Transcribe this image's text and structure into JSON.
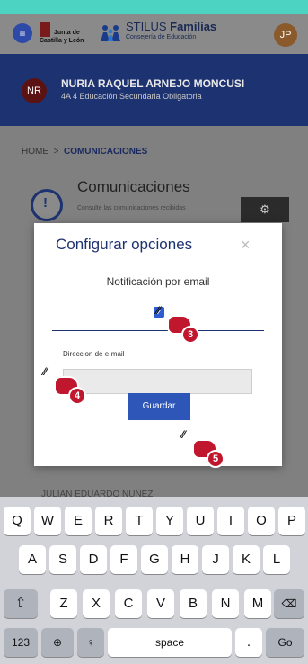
{
  "header": {
    "logo_line1": "Junta de",
    "logo_line2": "Castilla y León",
    "app_title_light": "STILUS",
    "app_title_bold": "Familias",
    "app_subtitle": "Consejería de Educación",
    "avatar_initials": "JP"
  },
  "user": {
    "initials": "NR",
    "name": "NURIA RAQUEL ARNEJO MONCUSI",
    "course": "4A 4 Educación Secundaria Obligatoria"
  },
  "breadcrumb": {
    "home": "HOME",
    "separator": ">",
    "current": "COMUNICACIONES"
  },
  "page": {
    "title": "Comunicaciones",
    "subtitle": "Consulte las comunicaciones recibidas",
    "background_item": "JULIAN EDUARDO NUÑEZ"
  },
  "modal": {
    "title": "Configurar opciones",
    "close": "×",
    "email_notification_label": "Notificación por email",
    "email_notification_checked": true,
    "email_label": "Direccion de e-mail",
    "email_value": "",
    "save_label": "Guardar"
  },
  "annotations": {
    "step3": "3",
    "step4": "4",
    "step5": "5"
  },
  "keyboard": {
    "row1": [
      "Q",
      "W",
      "E",
      "R",
      "T",
      "Y",
      "U",
      "I",
      "O",
      "P"
    ],
    "row2": [
      "A",
      "S",
      "D",
      "F",
      "G",
      "H",
      "J",
      "K",
      "L"
    ],
    "row3": [
      "Z",
      "X",
      "C",
      "V",
      "B",
      "N",
      "M"
    ],
    "numbers": "123",
    "space": "space",
    "period": ".",
    "go": "Go"
  },
  "colors": {
    "top_strip": "#4cd3c2",
    "user_band": "#1d3270",
    "primary_button": "#2e55b8",
    "annotation_red": "#c0172e"
  }
}
